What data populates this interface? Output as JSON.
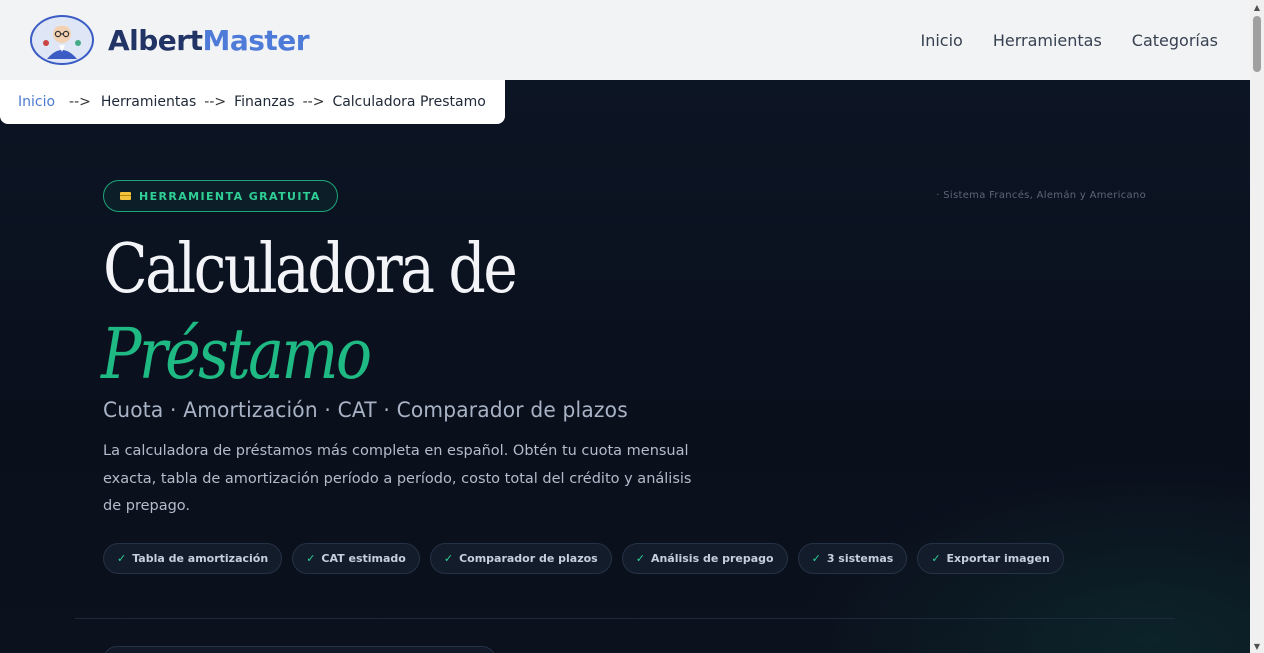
{
  "header": {
    "brand_part1": "Albert",
    "brand_part2": "Master",
    "nav": [
      "Inicio",
      "Herramientas",
      "Categorías"
    ]
  },
  "breadcrumb": {
    "items": [
      "Inicio",
      "Herramientas",
      "Finanzas",
      "Calculadora Prestamo"
    ],
    "separator": "-->"
  },
  "hero": {
    "badge": "HERRAMIENTA GRATUITA",
    "side_note": "· Sistema Francés, Alemán y Americano",
    "title_line1": "Calculadora de",
    "title_line2": "Préstamo",
    "subtitle": "Cuota · Amortización · CAT · Comparador de plazos",
    "description": "La calculadora de préstamos más completa en español. Obtén tu cuota mensual exacta, tabla de amortización período a período, costo total del crédito y análisis de prepago.",
    "features": [
      "Tabla de amortización",
      "CAT estimado",
      "Comparador de plazos",
      "Análisis de prepago",
      "3 sistemas",
      "Exportar imagen"
    ],
    "check_glyph": "✓"
  },
  "colors": {
    "accent_green": "#1fb983",
    "brand_blue": "#4f7bd8",
    "brand_navy": "#223366",
    "background": "#0b1220"
  },
  "icons": {
    "logo": "albert-master-logo-icon",
    "badge": "credit-card-icon",
    "feature": "check-icon"
  }
}
